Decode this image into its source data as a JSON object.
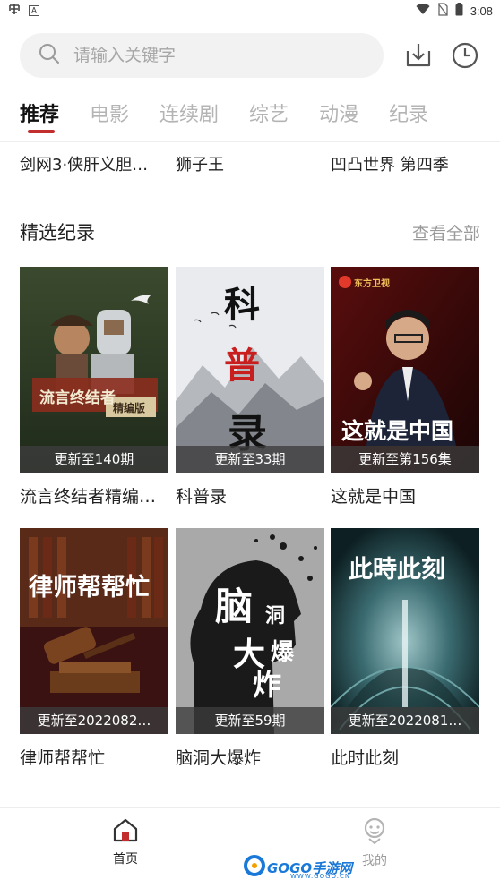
{
  "status_bar": {
    "left_icons": [
      "bug-icon",
      "a-icon"
    ],
    "time": "3:08",
    "right_icons": [
      "wifi-icon",
      "no-sim-icon",
      "battery-icon"
    ]
  },
  "search": {
    "placeholder": "请输入关键字"
  },
  "header_actions": [
    "download-icon",
    "history-icon"
  ],
  "tabs": [
    {
      "label": "推荐",
      "active": true
    },
    {
      "label": "电影",
      "active": false
    },
    {
      "label": "连续剧",
      "active": false
    },
    {
      "label": "综艺",
      "active": false
    },
    {
      "label": "动漫",
      "active": false
    },
    {
      "label": "纪录",
      "active": false
    }
  ],
  "previous_row": [
    "剑网3·侠肝义胆…",
    "狮子王",
    "凹凸世界 第四季"
  ],
  "section": {
    "title": "精选纪录",
    "more_label": "查看全部",
    "items": [
      {
        "title": "流言终结者精编…",
        "badge": "更新至140期",
        "poster_text": [
          "流言终结者",
          "精编版"
        ]
      },
      {
        "title": "科普录",
        "badge": "更新至33期",
        "poster_text": [
          "科",
          "普",
          "录"
        ]
      },
      {
        "title": "这就是中国",
        "badge": "更新至第156集",
        "poster_text": [
          "这就是中国",
          "东方卫视"
        ]
      },
      {
        "title": "律师帮帮忙",
        "badge": "更新至2022082…",
        "poster_text": [
          "律师帮帮忙"
        ]
      },
      {
        "title": "脑洞大爆炸",
        "badge": "更新至59期",
        "poster_text": [
          "脑",
          "洞",
          "大",
          "爆",
          "炸"
        ]
      },
      {
        "title": "此时此刻",
        "badge": "更新至2022081…",
        "poster_text": [
          "此時此刻"
        ]
      }
    ]
  },
  "bottom_nav": [
    {
      "label": "首页",
      "icon": "home-icon",
      "active": true
    },
    {
      "label": "我的",
      "icon": "profile-icon",
      "active": false
    }
  ],
  "watermark": {
    "text": "GOGO手游网",
    "sub": "WWW.GOGO.CN"
  },
  "colors": {
    "accent": "#c22d2d",
    "inactive_tab": "#b4b4b4",
    "search_bg": "#f2f2f2"
  }
}
